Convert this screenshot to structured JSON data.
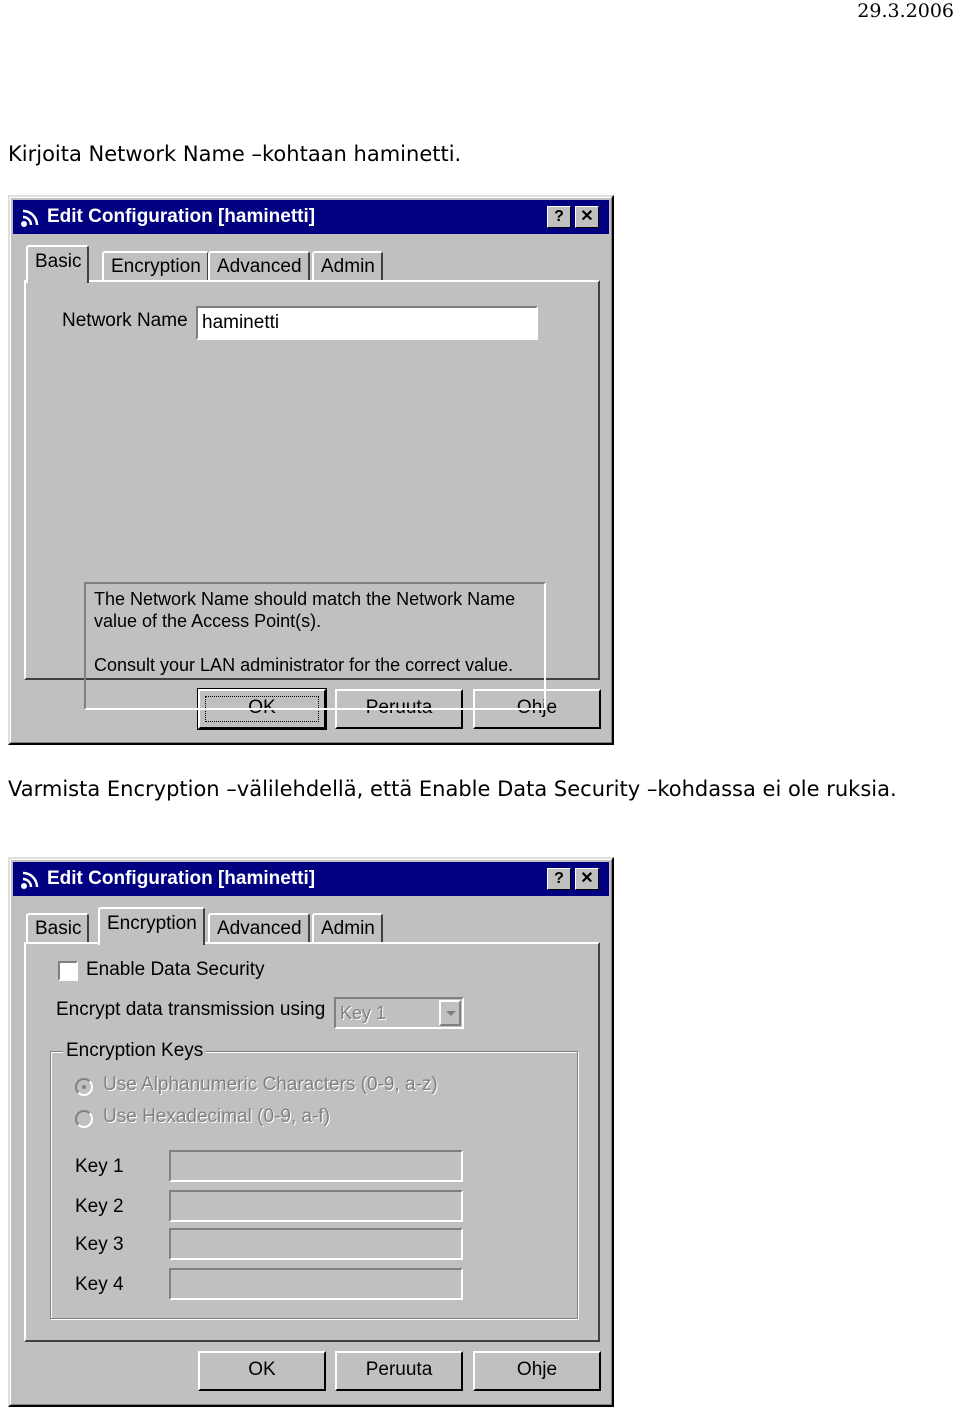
{
  "page": {
    "date": "29.3.2006",
    "instruction_1": "Kirjoita Network Name –kohtaan haminetti.",
    "instruction_2": "Varmista Encryption –välilehdellä, että Enable Data Security –kohdassa ei ole ruksia."
  },
  "dialog_1": {
    "title": "Edit Configuration [haminetti]",
    "help_button": "?",
    "close_button": "✕",
    "tabs": [
      "Basic",
      "Encryption",
      "Advanced",
      "Admin"
    ],
    "active_tab": "Basic",
    "network_name_label": "Network Name",
    "network_name_value": "haminetti",
    "info_line_1": "The Network Name should match the Network Name value of the Access Point(s).",
    "info_line_2": "Consult your LAN administrator for the correct value.",
    "buttons": {
      "ok": "OK",
      "cancel": "Peruuta",
      "help": "Ohje"
    }
  },
  "dialog_2": {
    "title": "Edit Configuration [haminetti]",
    "help_button": "?",
    "close_button": "✕",
    "tabs": [
      "Basic",
      "Encryption",
      "Advanced",
      "Admin"
    ],
    "active_tab": "Encryption",
    "enable_data_security_label": "Enable Data Security",
    "enable_data_security_checked": false,
    "encrypt_label": "Encrypt data transmission using",
    "encrypt_select_value": "Key 1",
    "encryption_keys_group": "Encryption Keys",
    "radio_alphanumeric": "Use Alphanumeric Characters (0-9, a-z)",
    "radio_hexadecimal": "Use Hexadecimal (0-9, a-f)",
    "keys": [
      "Key 1",
      "Key 2",
      "Key 3",
      "Key 4"
    ],
    "buttons": {
      "ok": "OK",
      "cancel": "Peruuta",
      "help": "Ohje"
    }
  },
  "colors": {
    "titlebar": "#000080",
    "face": "#c0c0c0",
    "disabled_text": "#808080"
  }
}
